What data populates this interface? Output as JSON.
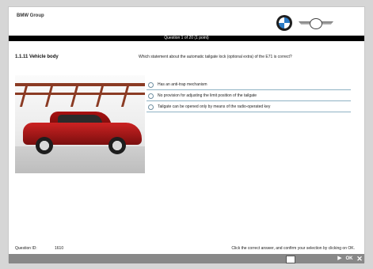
{
  "header": {
    "brand": "BMW Group"
  },
  "question_bar": {
    "text": "Question 1 of 20 (1 point)"
  },
  "section": {
    "title": "1.1.11 Vehicle body"
  },
  "question": {
    "text": "Which statement about the automatic tailgate lock (optional extra) of the E71 is correct?"
  },
  "answers": [
    {
      "label": "Has an anti-trap mechanism"
    },
    {
      "label": "No provision for adjusting the limit position of the tailgate"
    },
    {
      "label": "Tailgate can be opened only by means of the radio-operated key"
    }
  ],
  "footer_info": {
    "question_id_label": "Question ID:",
    "question_id_value": "1610",
    "instruction": "Click the correct answer, and confirm your selection by clicking on OK."
  },
  "footer_buttons": {
    "ok_label": "OK",
    "next_glyph": "▶",
    "close_glyph": "✕"
  }
}
